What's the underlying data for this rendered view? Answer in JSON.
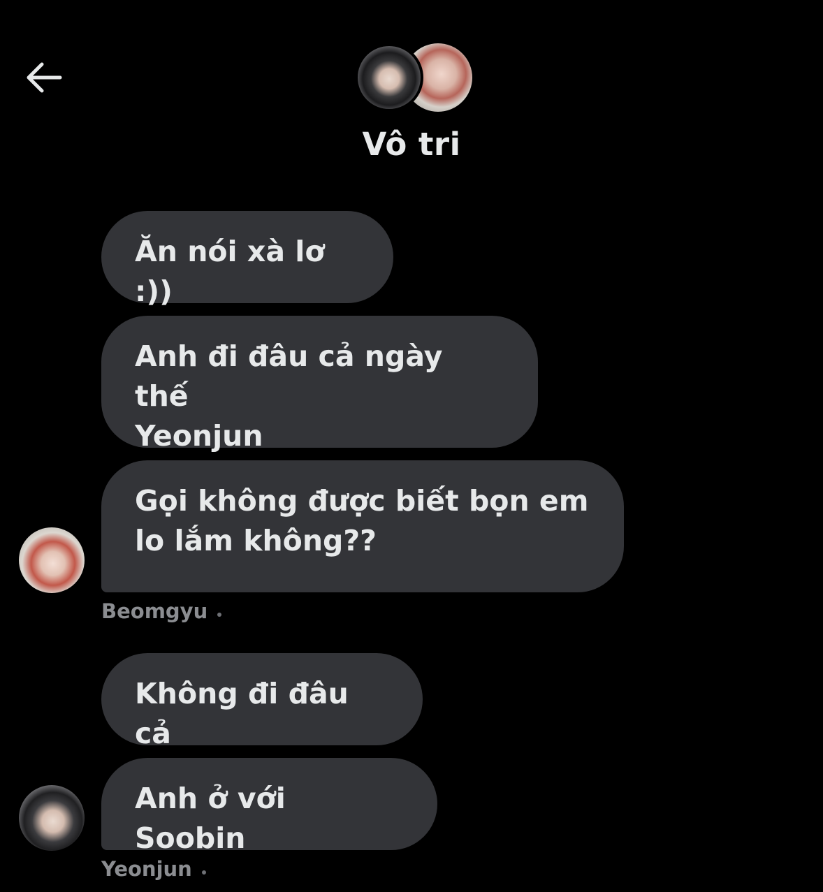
{
  "header": {
    "back_icon": "arrow-left-icon",
    "title": "Vô tri"
  },
  "messages": [
    {
      "text": "Ăn nói xà lơ :))"
    },
    {
      "text": "Anh đi đâu cả ngày thế\nYeonjun"
    },
    {
      "text": "Gọi không được biết bọn em\nlo lắm không??"
    },
    {
      "text": "Không đi đâu cả"
    },
    {
      "text": "Anh ở với Soobin"
    }
  ],
  "senders": [
    {
      "name": "Beomgyu"
    },
    {
      "name": "Yeonjun"
    }
  ],
  "colors": {
    "background": "#000000",
    "bubble": "#333438",
    "text": "#e7e9ea",
    "sender_text": "#8b8d91"
  }
}
